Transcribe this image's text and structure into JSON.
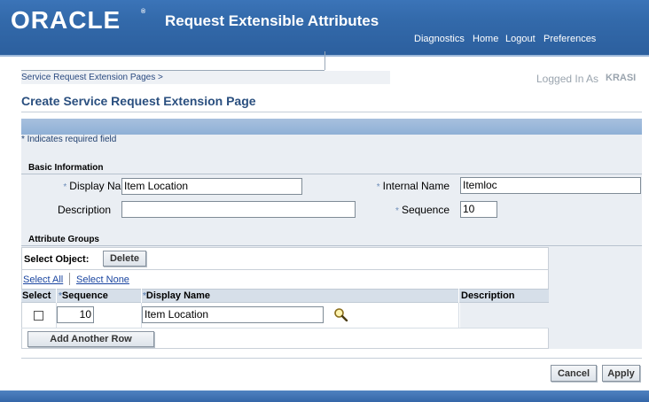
{
  "header": {
    "logo": "ORACLE",
    "logo_mark": "®",
    "app_title": "Request Extensible Attributes",
    "links": [
      "Diagnostics",
      "Home",
      "Logout",
      "Preferences"
    ]
  },
  "breadcrumb": "Service Request Extension Pages  >",
  "logged_in": {
    "label": "Logged In As",
    "user": "KRASI"
  },
  "page_title": "Create Service Request Extension Page",
  "required_note": "* Indicates required field",
  "basic_info": {
    "section_title": "Basic Information",
    "display_name": {
      "label": "Display Name",
      "value": "Item Location",
      "required": true
    },
    "internal_name": {
      "label": "Internal Name",
      "value": "Itemloc",
      "required": true
    },
    "description": {
      "label": "Description",
      "value": ""
    },
    "sequence": {
      "label": "Sequence",
      "value": "10",
      "required": true
    }
  },
  "attribute_groups": {
    "section_title": "Attribute Groups",
    "select_object_label": "Select Object:",
    "delete_label": "Delete",
    "select_all": "Select All",
    "select_none": "Select None",
    "columns": [
      "Select",
      "Sequence",
      "Display Name",
      "Description"
    ],
    "rows": [
      {
        "sequence": "10",
        "display_name": "Item Location",
        "description": ""
      }
    ],
    "add_row_label": "Add Another Row"
  },
  "actions": {
    "cancel": "Cancel",
    "apply": "Apply"
  },
  "colors": {
    "header_blue": "#336aab",
    "title_blue": "#2a4f7f",
    "link_blue": "#1a45a0",
    "panel_bg": "#eaeef3"
  }
}
